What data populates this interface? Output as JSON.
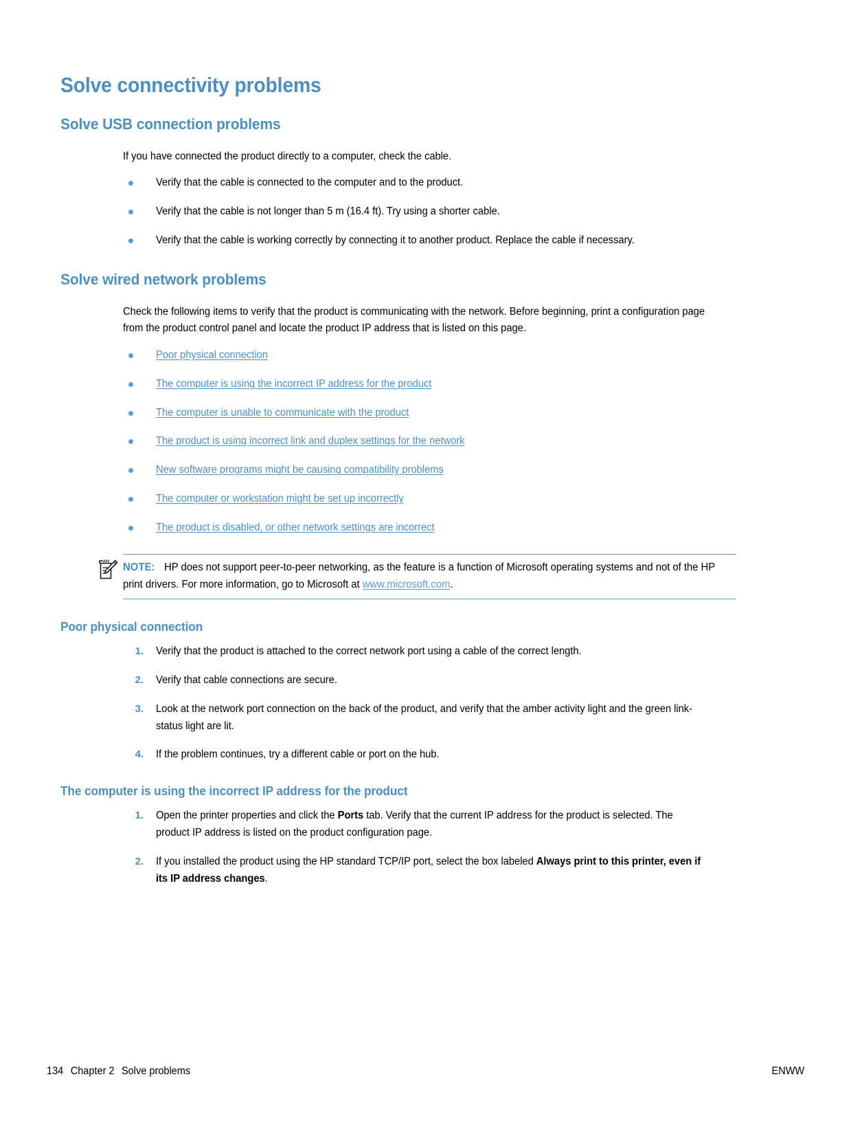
{
  "document": {
    "title": "Solve connectivity problems"
  },
  "sections": {
    "usb": {
      "heading": "Solve USB connection problems",
      "intro": "If you have connected the product directly to a computer, check the cable.",
      "bullets": [
        "Verify that the cable is connected to the computer and to the product.",
        "Verify that the cable is not longer than 5 m (16.4 ft). Try using a shorter cable.",
        "Verify that the cable is working correctly by connecting it to another product. Replace the cable if necessary."
      ]
    },
    "wired": {
      "heading": "Solve wired network problems",
      "intro": "Check the following items to verify that the product is communicating with the network. Before beginning, print a configuration page from the product control panel and locate the product IP address that is listed on this page.",
      "links": [
        "Poor physical connection",
        "The computer is using the incorrect IP address for the product",
        "The computer is unable to communicate with the product",
        "The product is using incorrect link and duplex settings for the network",
        "New software programs might be causing compatibility problems",
        "The computer or workstation might be set up incorrectly",
        "The product is disabled, or other network settings are incorrect"
      ]
    },
    "note": {
      "icon": "note-pencil-icon",
      "label": "NOTE:",
      "text_before_link": "HP does not support peer-to-peer networking, as the feature is a function of Microsoft operating systems and not of the HP print drivers. For more information, go to Microsoft at ",
      "link_text": "www.microsoft.com",
      "text_after_link": "."
    },
    "poor_physical": {
      "heading": "Poor physical connection",
      "steps": [
        {
          "marker": "1.",
          "text": "Verify that the product is attached to the correct network port using a cable of the correct length."
        },
        {
          "marker": "2.",
          "text": "Verify that cable connections are secure."
        },
        {
          "marker": "3.",
          "text": "Look at the network port connection on the back of the product, and verify that the amber activity light and the green link-status light are lit."
        },
        {
          "marker": "4.",
          "text": "If the problem continues, try a different cable or port on the hub."
        }
      ]
    },
    "incorrect_ip": {
      "heading": "The computer is using the incorrect IP address for the product",
      "steps": [
        {
          "marker": "1.",
          "part1": "Open the printer properties and click the ",
          "bold1": "Ports",
          "part2": " tab. Verify that the current IP address for the product is selected. The product IP address is listed on the product configuration page."
        },
        {
          "marker": "2.",
          "part1": "If you installed the product using the HP standard TCP/IP port, select the box labeled ",
          "bold1": "Always print to this printer, even if its IP address changes",
          "part2": "."
        }
      ]
    }
  },
  "footer": {
    "page_number": "134",
    "chapter": "Chapter 2",
    "chapter_title": "Solve problems",
    "edition": "ENWW"
  },
  "colors": {
    "heading_blue": "#4a90c4",
    "accent_blue": "#5b9bd1",
    "body_black": "#000000"
  }
}
